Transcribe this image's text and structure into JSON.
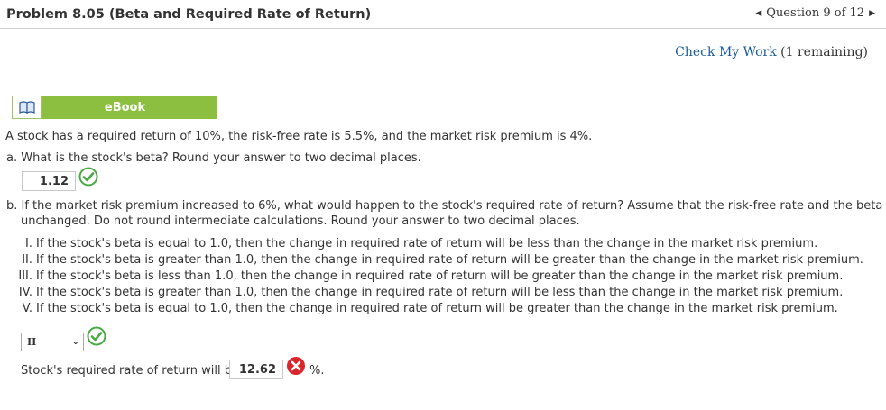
{
  "header": {
    "title": "Problem 8.05 (Beta and Required Rate of Return)",
    "question_nav": "Question 9 of 12"
  },
  "check_work": {
    "link": "Check My Work",
    "remaining": "(1 remaining)"
  },
  "ebook": {
    "label": "eBook"
  },
  "problem": {
    "intro": "A stock has a required return of 10%, the risk-free rate is 5.5%, and the market risk premium is 4%.",
    "part_a": {
      "question": "a. What is the stock's beta? Round your answer to two decimal places.",
      "answer": "1.12",
      "status": "correct"
    },
    "part_b": {
      "question_line1": "b. If the market risk premium increased to 6%, what would happen to the stock's required rate of return? Assume that the risk-free rate and the beta remain",
      "question_line2": "unchanged. Do not round intermediate calculations. Round your answer to two decimal places.",
      "options": [
        {
          "num": "I.",
          "text": "If the stock's beta is equal to 1.0, then the change in required rate of return will be less than the change in the market risk premium."
        },
        {
          "num": "II.",
          "text": "If the stock's beta is greater than 1.0, then the change in required rate of return will be greater than the change in the market risk premium."
        },
        {
          "num": "III.",
          "text": "If the stock's beta is less than 1.0, then the change in required rate of return will be greater than the change in the market risk premium."
        },
        {
          "num": "IV.",
          "text": "If the stock's beta is greater than 1.0, then the change in required rate of return will be less than the change in the market risk premium."
        },
        {
          "num": "V.",
          "text": "If the stock's beta is equal to 1.0, then the change in required rate of return will be greater than the change in the market risk premium."
        }
      ],
      "selected": "II",
      "select_status": "correct",
      "return_label": "Stock's required rate of return will be",
      "return_value": "12.62",
      "return_status": "incorrect",
      "return_unit": "%."
    }
  },
  "colors": {
    "ebook_green": "#8cbf3f",
    "link_blue": "#1a5c99",
    "correct_green": "#49a942",
    "incorrect_red": "#d9262c"
  },
  "icons": {
    "ebook": "book-icon",
    "correct": "checkmark-circle-icon",
    "incorrect": "x-circle-icon",
    "prev": "triangle-left-icon",
    "next": "triangle-right-icon"
  }
}
